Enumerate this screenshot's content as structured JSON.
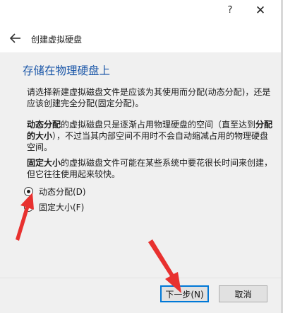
{
  "titlebar": {
    "help_label": "?",
    "close_label": "✕"
  },
  "nav": {
    "title": "创建虚拟硬盘"
  },
  "main": {
    "heading": "存储在物理硬盘上",
    "intro": "请选择新建虚拟磁盘文件是应该为其使用而分配(动态分配)，还是应该创建完全分配(固定分配)。",
    "dynamic_desc": {
      "bold1": "动态分配",
      "text1": "的虚拟磁盘只是逐渐占用物理硬盘的空间（直至达到",
      "bold2": "分配的大小",
      "text2": "），不过当其内部空间不用时不会自动缩减占用的物理硬盘空间。"
    },
    "fixed_desc": {
      "bold1": "固定大小",
      "text1": "的虚拟磁盘文件可能在某些系统中要花很长时间来创建，但它往往使用起来较快。"
    },
    "options": [
      {
        "label": "动态分配(D)",
        "checked": true
      },
      {
        "label": "固定大小(F)",
        "checked": false
      }
    ]
  },
  "footer": {
    "next_label": "下一步(N)",
    "cancel_label": "取消"
  },
  "colors": {
    "heading": "#1a56a8",
    "annotation_arrow": "#e8312f",
    "primary_border": "#0078d7"
  }
}
